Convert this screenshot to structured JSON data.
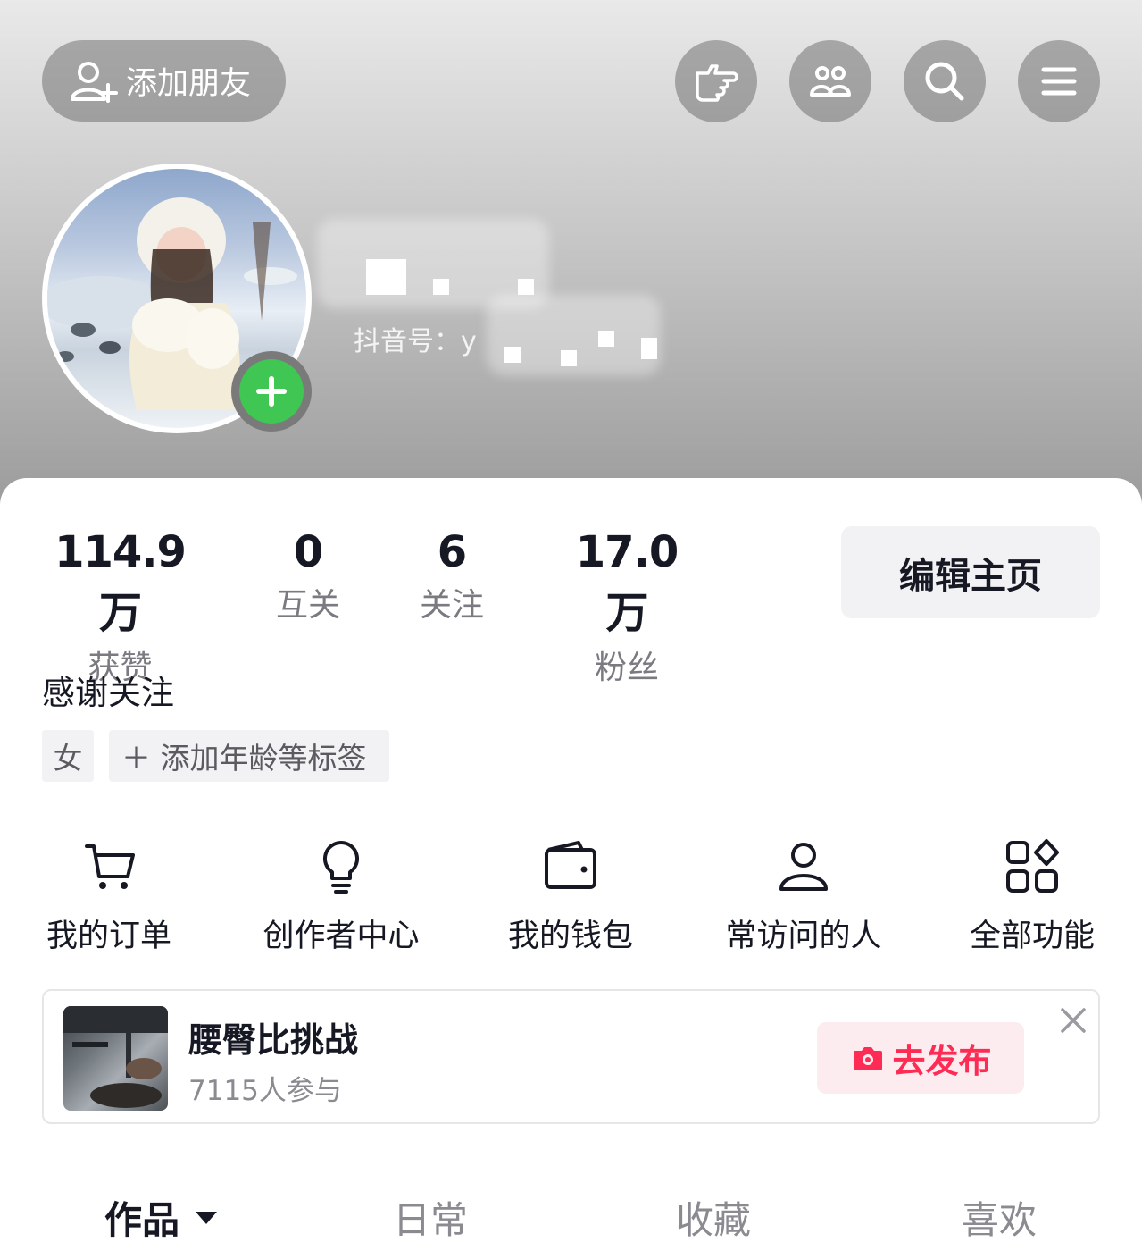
{
  "header": {
    "add_friend_label": "添加朋友",
    "top_icons": [
      "pointing-hand-icon",
      "friends-icon",
      "search-icon",
      "menu-icon"
    ]
  },
  "profile": {
    "douyin_id_label": "抖音号：y"
  },
  "stats": [
    {
      "value": "114.9万",
      "label": "获赞"
    },
    {
      "value": "0",
      "label": "互关"
    },
    {
      "value": "6",
      "label": "关注"
    },
    {
      "value": "17.0万",
      "label": "粉丝"
    }
  ],
  "edit_profile_label": "编辑主页",
  "bio": "感谢关注",
  "tags": {
    "gender": "女",
    "add_tag": "＋ 添加年龄等标签"
  },
  "functions": [
    {
      "label": "我的订单",
      "icon": "cart-icon"
    },
    {
      "label": "创作者中心",
      "icon": "lightbulb-icon"
    },
    {
      "label": "我的钱包",
      "icon": "wallet-icon"
    },
    {
      "label": "常访问的人",
      "icon": "person-icon"
    },
    {
      "label": "全部功能",
      "icon": "grid-icon"
    }
  ],
  "challenge": {
    "title": "腰臀比挑战",
    "participants": "7115人参与",
    "publish_label": "去发布"
  },
  "tabs": [
    {
      "label": "作品",
      "active": true
    },
    {
      "label": "日常",
      "active": false
    },
    {
      "label": "收藏",
      "active": false
    },
    {
      "label": "喜欢",
      "active": false
    }
  ],
  "colors": {
    "accent": "#fe2c55",
    "green_badge": "#3fc653"
  }
}
